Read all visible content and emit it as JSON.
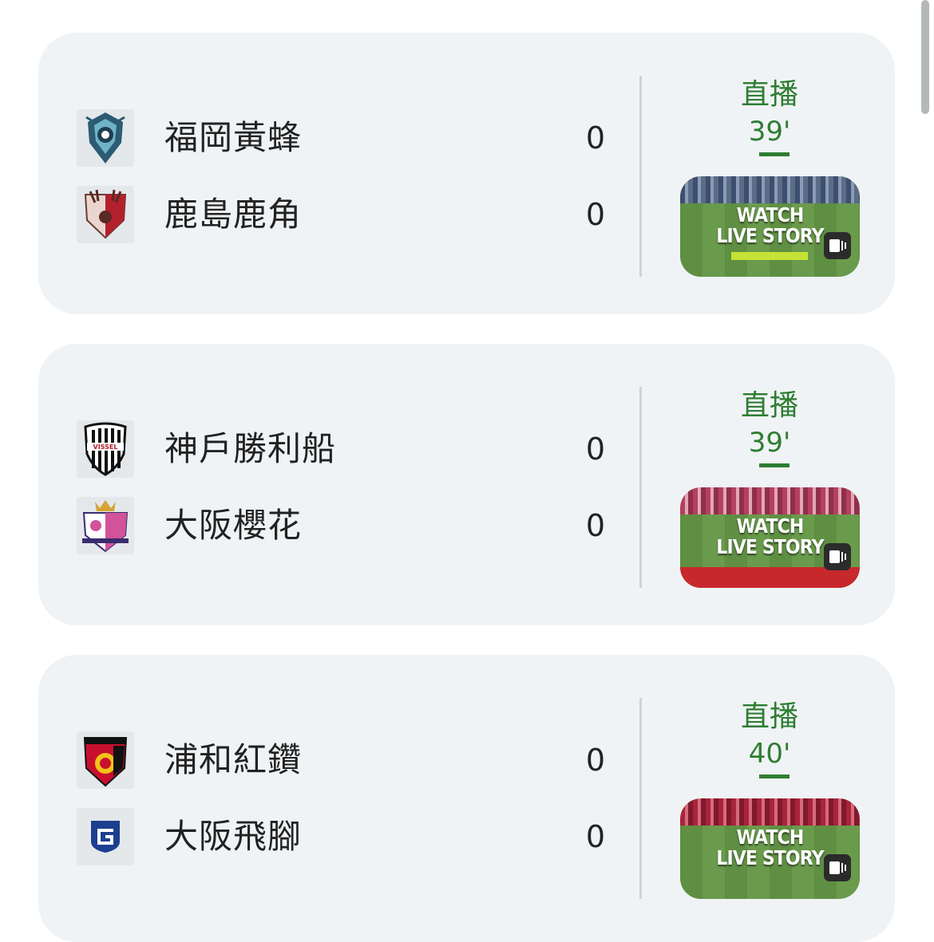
{
  "matches": [
    {
      "home": {
        "name": "福岡黃蜂",
        "score": "0",
        "logo": "avispa-fukuoka-crest-icon"
      },
      "away": {
        "name": "鹿島鹿角",
        "score": "0",
        "logo": "kashima-antlers-crest-icon"
      },
      "status": "直播",
      "minute": "39'",
      "thumbnail": {
        "title_line1": "WATCH",
        "title_line2": "LIVE STORY",
        "icon": "story-play-icon"
      }
    },
    {
      "home": {
        "name": "神戶勝利船",
        "score": "0",
        "logo": "vissel-kobe-crest-icon"
      },
      "away": {
        "name": "大阪櫻花",
        "score": "0",
        "logo": "cerezo-osaka-crest-icon"
      },
      "status": "直播",
      "minute": "39'",
      "thumbnail": {
        "title_line1": "WATCH",
        "title_line2": "LIVE STORY",
        "icon": "story-play-icon"
      }
    },
    {
      "home": {
        "name": "浦和紅鑽",
        "score": "0",
        "logo": "urawa-reds-crest-icon"
      },
      "away": {
        "name": "大阪飛腳",
        "score": "0",
        "logo": "gamba-osaka-crest-icon"
      },
      "status": "直播",
      "minute": "40'",
      "thumbnail": {
        "title_line1": "WATCH",
        "title_line2": "LIVE STORY",
        "icon": "story-play-icon"
      }
    }
  ],
  "colors": {
    "live_green": "#2e7d32",
    "card_background": "#f0f3f5"
  }
}
